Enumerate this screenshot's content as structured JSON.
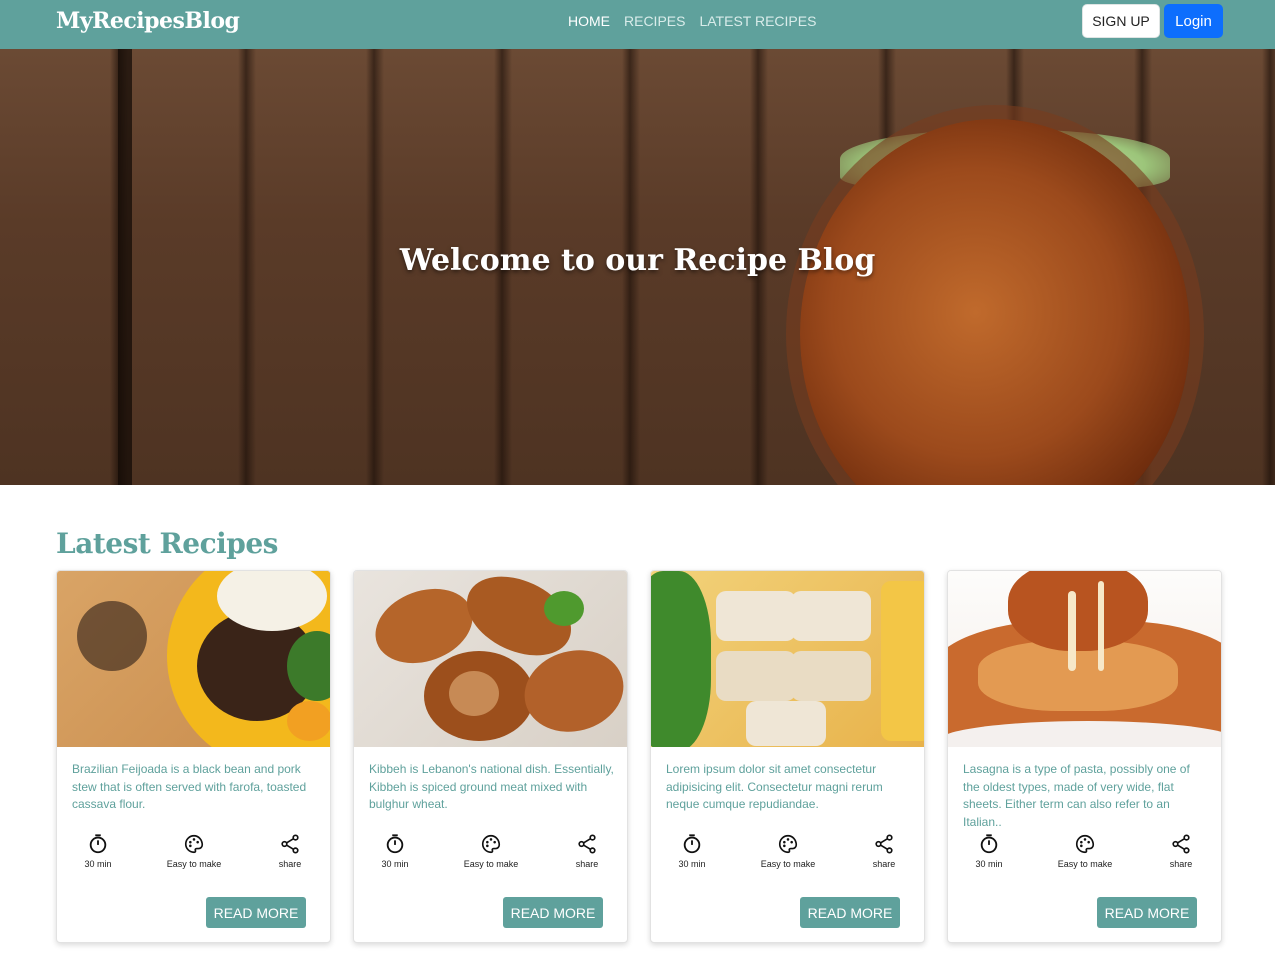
{
  "brand": "MyRecipesBlog",
  "nav": {
    "links": [
      "HOME",
      "RECIPES",
      "LATEST RECIPES"
    ],
    "signup_label": "SIGN UP",
    "login_label": "Login"
  },
  "hero": {
    "title": "Welcome to our Recipe Blog"
  },
  "latest": {
    "title": "Latest Recipes",
    "cards": [
      {
        "text": "Brazilian Feijoada is a black bean and pork stew that is often served with farofa, toasted cassava flour.",
        "time": "30 min",
        "difficulty": "Easy to make",
        "share": "share",
        "button": "READ MORE"
      },
      {
        "text": "Kibbeh is Lebanon's national dish. Essentially, Kibbeh is spiced ground meat mixed with bulghur wheat.",
        "time": "30 min",
        "difficulty": "Easy to make",
        "share": "share",
        "button": "READ MORE"
      },
      {
        "text": "Lorem ipsum dolor sit amet consectetur adipisicing elit. Consectetur magni rerum neque cumque repudiandae.",
        "time": "30 min",
        "difficulty": "Easy to make",
        "share": "share",
        "button": "READ MORE"
      },
      {
        "text": "Lasagna is a type of pasta, possibly one of the oldest types, made of very wide, flat sheets. Either term can also refer to an Italian..",
        "time": "30 min",
        "difficulty": "Easy to make",
        "share": "share",
        "button": "READ MORE"
      }
    ]
  },
  "colors": {
    "teal": "#5fa19c",
    "login_blue": "#0d6efd"
  }
}
